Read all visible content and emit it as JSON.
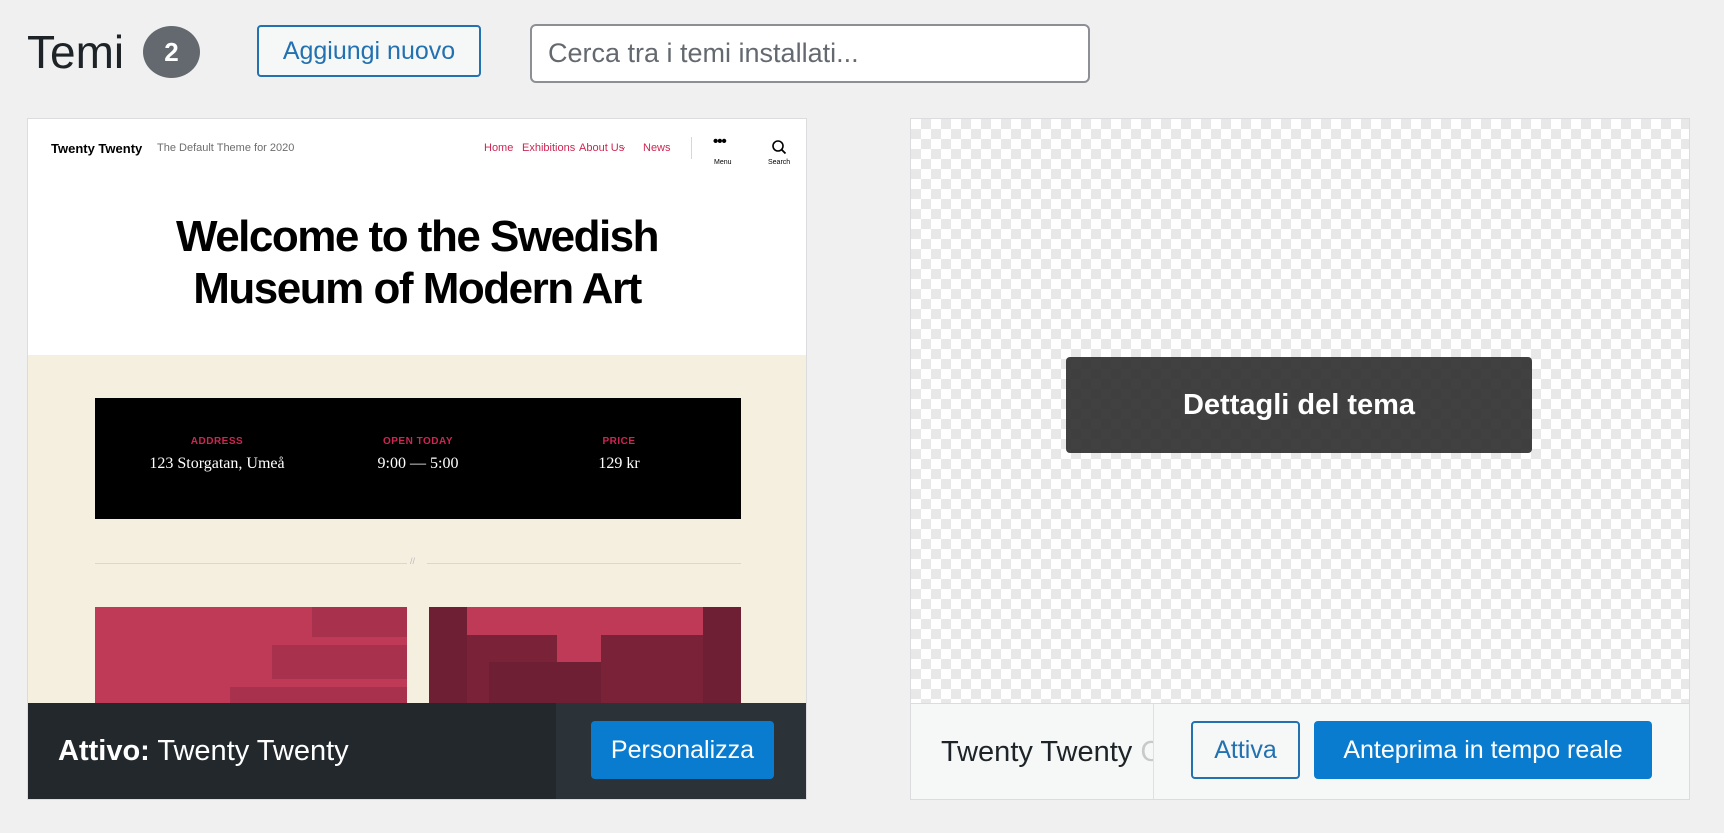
{
  "header": {
    "title": "Temi",
    "count": "2",
    "add_new_label": "Aggiungi nuovo",
    "search_placeholder": "Cerca tra i temi installati..."
  },
  "themes": [
    {
      "screenshot": {
        "site_title": "Twenty Twenty",
        "site_description": "The Default Theme for 2020",
        "nav": [
          "Home",
          "Exhibitions",
          "About Us",
          "News"
        ],
        "menu_label": "Menu",
        "search_label": "Search",
        "hero_line1": "Welcome to the Swedish",
        "hero_line2": "Museum of Modern Art",
        "info": [
          {
            "label": "ADDRESS",
            "value": "123 Storgatan, Umeå"
          },
          {
            "label": "OPEN TODAY",
            "value": "9:00 — 5:00"
          },
          {
            "label": "PRICE",
            "value": "129 kr"
          }
        ],
        "separator": "//"
      },
      "active_prefix": "Attivo:",
      "name": "Twenty Twenty",
      "customize_label": "Personalizza"
    },
    {
      "details_label": "Dettagli del tema",
      "name_visible": "Twenty Twenty",
      "name_faded": "Ch",
      "activate_label": "Attiva",
      "live_preview_label": "Anteprima in tempo reale"
    }
  ],
  "colors": {
    "accent": "#0a7ccf",
    "link": "#2271b1",
    "twentytwenty_accent": "#cd2653",
    "active_bar": "#23282d"
  }
}
